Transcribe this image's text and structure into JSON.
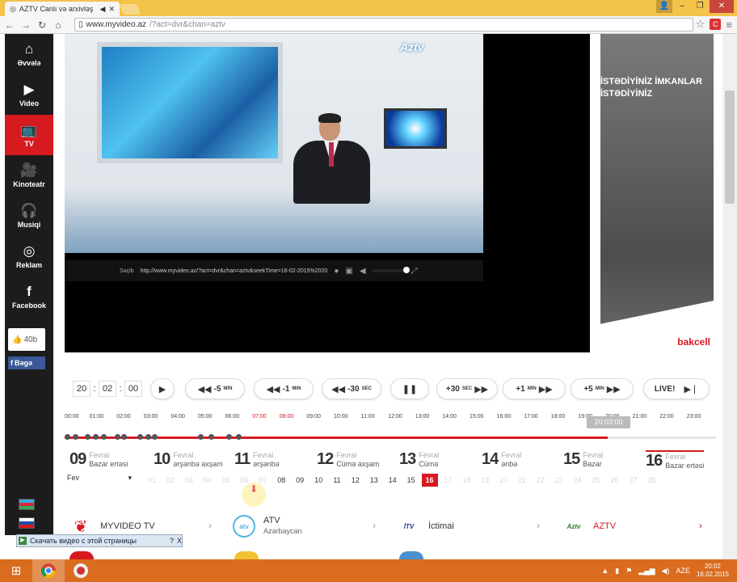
{
  "browser": {
    "tab_title": "AZTV Canlı və arxivləş",
    "url_host": "www.myvideo.az",
    "url_path": "/?act=dvr&chan=aztv"
  },
  "sidebar": {
    "items": [
      {
        "label": "Əvvələ",
        "icon": "home-icon"
      },
      {
        "label": "Video",
        "icon": "play-icon"
      },
      {
        "label": "TV",
        "icon": "tv-icon"
      },
      {
        "label": "Kinoteatr",
        "icon": "camera-icon"
      },
      {
        "label": "Musiqi",
        "icon": "headphones-icon"
      },
      {
        "label": "Reklam",
        "icon": "target-icon"
      },
      {
        "label": "Facebook",
        "icon": "facebook-icon"
      }
    ],
    "like_count": "40b",
    "share_label": "Bəgə"
  },
  "player": {
    "logo": "Aztv",
    "share_label": "Səçib",
    "share_url": "http://www.myvideo.az/?act=dvr&chan=aztv&seekTime=16-02-2015%2020"
  },
  "ad": {
    "line1": "İSTƏDİYİNİZ İMKANLAR",
    "line2": "İSTƏDİYİNİZ",
    "brand": "bakcell"
  },
  "time": {
    "hh": "20",
    "mm": "02",
    "ss": "00"
  },
  "buttons": {
    "m5": "-5",
    "m1": "-1",
    "m30": "-30",
    "p30": "+30",
    "p1": "+1",
    "p5": "+5",
    "min": "MIN",
    "sec": "SEC",
    "live": "LIVE!"
  },
  "hours": [
    "00:00",
    "01:00",
    "02:00",
    "03:00",
    "04:00",
    "05:00",
    "06:00",
    "07:00",
    "08:00",
    "09:00",
    "10:00",
    "11:00",
    "12:00",
    "13:00",
    "14:00",
    "15:00",
    "16:00",
    "17:00",
    "18:00",
    "19:00",
    "20:00",
    "21:00",
    "22:00",
    "23:00"
  ],
  "tooltip_time": "20:03:00",
  "days": [
    {
      "num": "09",
      "month": "Fevral",
      "name": "Bazar ertəsi"
    },
    {
      "num": "10",
      "month": "Fevral",
      "name": "ərşənbə axşam"
    },
    {
      "num": "11",
      "month": "Fevral",
      "name": "ərşənbə"
    },
    {
      "num": "12",
      "month": "Fevral",
      "name": "Cümə axşam"
    },
    {
      "num": "13",
      "month": "Fevral",
      "name": "Cümə"
    },
    {
      "num": "14",
      "month": "Fevral",
      "name": "ənbə"
    },
    {
      "num": "15",
      "month": "Fevral",
      "name": "Bazar"
    },
    {
      "num": "16",
      "month": "Fevral",
      "name": "Bazar ertəsi"
    }
  ],
  "month_select": "Fev",
  "date_numbers": [
    "01",
    "02",
    "03",
    "04",
    "05",
    "06",
    "07",
    "08",
    "09",
    "10",
    "11",
    "12",
    "13",
    "14",
    "15",
    "16",
    "17",
    "18",
    "19",
    "20",
    "21",
    "22",
    "23",
    "24",
    "25",
    "26",
    "27",
    "28"
  ],
  "selected_date": "16",
  "channels": [
    {
      "name": "MYVIDEO TV",
      "sub": ""
    },
    {
      "name": "ATV",
      "sub": "Azərbaycan"
    },
    {
      "name": "İctimai",
      "sub": ""
    },
    {
      "name": "AZTV",
      "sub": ""
    }
  ],
  "channel_logos": {
    "atv": "atv",
    "itv": "İTV",
    "aztv": "Aztv"
  },
  "download_bar": {
    "label": "Скачать видео с этой страницы",
    "help": "?",
    "close": "X"
  },
  "taskbar": {
    "lang": "AZE",
    "time": "20:02",
    "date": "16.02.2015"
  },
  "colors": {
    "accent": "#d71920",
    "sidebar": "#1c1c1c",
    "taskbar": "#d96c1e"
  }
}
